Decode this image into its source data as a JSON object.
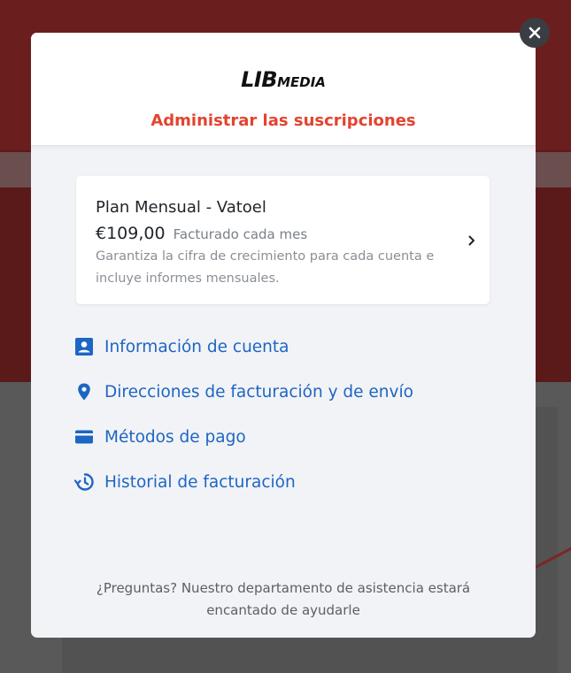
{
  "brand": {
    "logo_lib": "LIB",
    "logo_media": "MEDIA"
  },
  "modal": {
    "title": "Administrar las suscripciones"
  },
  "plan": {
    "name": "Plan Mensual - Vatoel",
    "price": "€109,00",
    "billing": "Facturado cada mes",
    "description": "Garantiza la cifra de crecimiento para cada cuenta e incluye informes mensuales."
  },
  "links": [
    {
      "label": "Información de cuenta",
      "icon": "account-box-icon"
    },
    {
      "label": "Direcciones de facturación y de envío",
      "icon": "location-pin-icon"
    },
    {
      "label": "Métodos de pago",
      "icon": "credit-card-icon"
    },
    {
      "label": "Historial de facturación",
      "icon": "history-icon"
    }
  ],
  "footer": {
    "text": "¿Preguntas? Nuestro departamento de asistencia estará encantado de ayudarle"
  },
  "colors": {
    "accent_red": "#e2442f",
    "link_blue": "#1d66c2",
    "modal_bg": "#f2f3f7"
  }
}
